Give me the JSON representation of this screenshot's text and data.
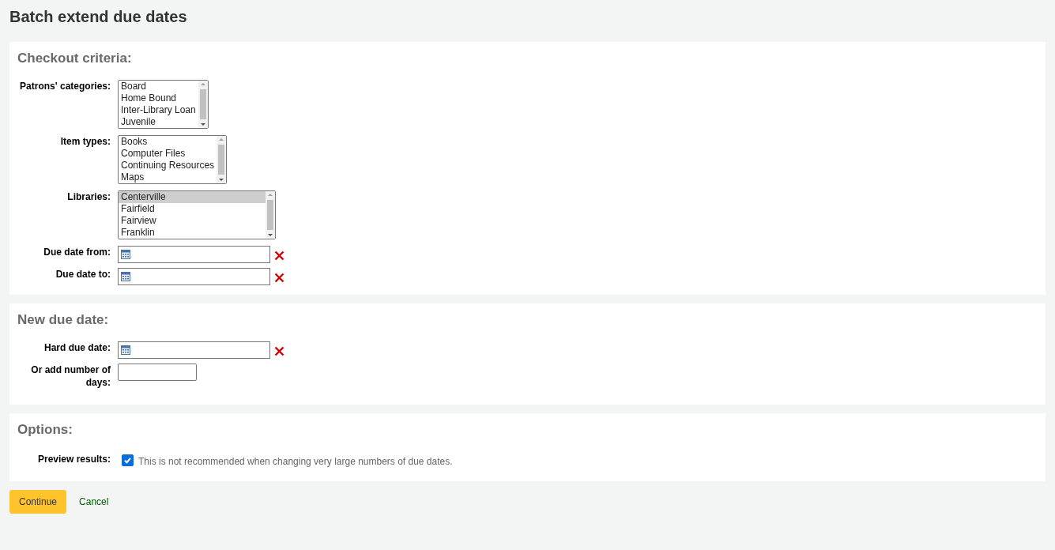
{
  "title": "Batch extend due dates",
  "sections": [
    {
      "heading": "Checkout criteria:",
      "fields": [
        {
          "kind": "listbox",
          "label": "Patrons' categories:",
          "options": [
            {
              "text": "Board",
              "selected": false
            },
            {
              "text": "Home Bound",
              "selected": false
            },
            {
              "text": "Inter-Library Loan",
              "selected": false
            },
            {
              "text": "Juvenile",
              "selected": false
            }
          ]
        },
        {
          "kind": "listbox",
          "label": "Item types:",
          "options": [
            {
              "text": "Books",
              "selected": false
            },
            {
              "text": "Computer Files",
              "selected": false
            },
            {
              "text": "Continuing Resources",
              "selected": false
            },
            {
              "text": "Maps",
              "selected": false
            }
          ]
        },
        {
          "kind": "listbox",
          "label": "Libraries:",
          "options": [
            {
              "text": "Centerville",
              "selected": true
            },
            {
              "text": "Fairfield",
              "selected": false
            },
            {
              "text": "Fairview",
              "selected": false
            },
            {
              "text": "Franklin",
              "selected": false
            }
          ]
        },
        {
          "kind": "date",
          "label": "Due date from:"
        },
        {
          "kind": "date",
          "label": "Due date to:"
        }
      ]
    },
    {
      "heading": "New due date:",
      "fields": [
        {
          "kind": "date",
          "label": "Hard due date:"
        },
        {
          "kind": "number",
          "label": "Or add number of days:"
        }
      ]
    },
    {
      "heading": "Options:",
      "fields": [
        {
          "kind": "checkbox",
          "label": "Preview results:",
          "checked": true,
          "hint": "This is not recommended when changing very large numbers of due dates."
        }
      ]
    }
  ],
  "actions": {
    "submit": "Continue",
    "cancel": "Cancel"
  }
}
